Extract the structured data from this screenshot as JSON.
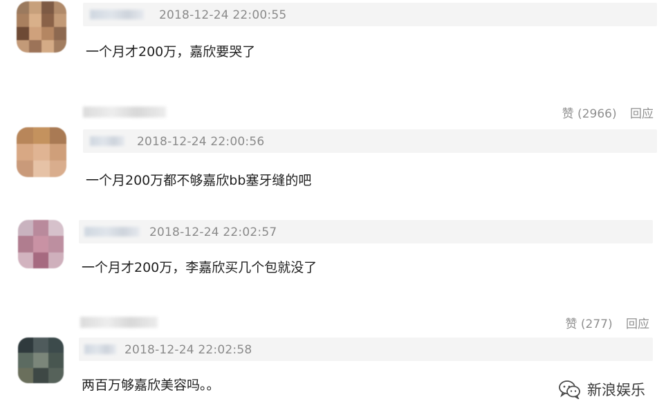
{
  "comments": [
    {
      "timestamp": "2018-12-24 22:00:55",
      "text": "一个月才200万，嘉欣要哭了",
      "likes_label": "赞 (2966)",
      "reply_label": "回应"
    },
    {
      "timestamp": "2018-12-24 22:00:56",
      "text": "一个月200万都不够嘉欣bb塞牙缝的吧"
    },
    {
      "timestamp": "2018-12-24 22:02:57",
      "text": "一个月才200万，李嘉欣买几个包就没了",
      "likes_label": "赞 (277)",
      "reply_label": "回应"
    },
    {
      "timestamp": "2018-12-24 22:02:58",
      "text": "两百万够嘉欣美容吗。。"
    }
  ],
  "watermark": {
    "text": "新浪娱乐",
    "icon": "wechat-icon"
  },
  "colors": {
    "meta_bar_bg": "#f4f4f4",
    "timestamp": "#8a8a8a",
    "actions": "#8f8f8f",
    "text": "#1f1f1f"
  }
}
